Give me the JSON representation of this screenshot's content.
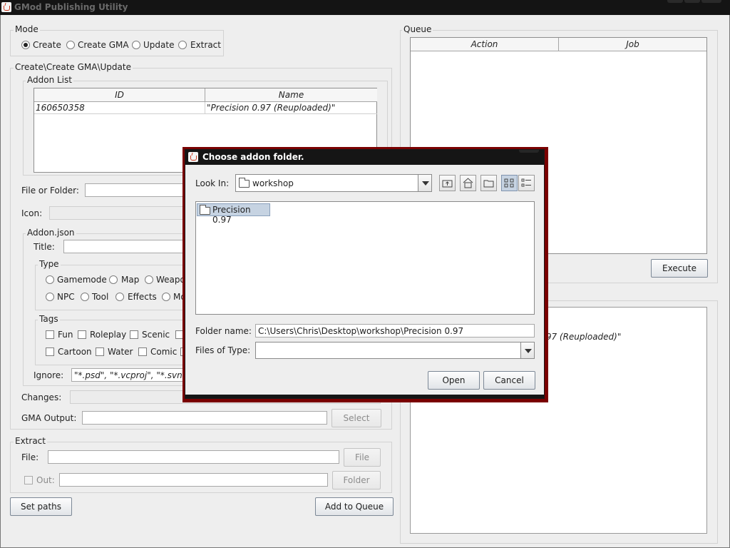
{
  "window": {
    "title": "GMod Publishing Utility"
  },
  "mode": {
    "label": "Mode",
    "options": [
      "Create",
      "Create GMA",
      "Update",
      "Extract"
    ],
    "selected": "Create"
  },
  "create": {
    "label": "Create\\Create GMA\\Update",
    "addon_list": {
      "label": "Addon List",
      "columns": [
        "ID",
        "Name"
      ],
      "rows": [
        {
          "id": "160650358",
          "name": "\"Precision 0.97 (Reuploaded)\""
        }
      ]
    },
    "file_or_folder_label": "File or Folder:",
    "icon_label": "Icon:",
    "addon_json": {
      "label": "Addon.json",
      "title_label": "Title:",
      "type_label": "Type",
      "types": [
        "Gamemode",
        "Map",
        "Weapo",
        "NPC",
        "Tool",
        "Effects",
        "Mo"
      ],
      "tags_label": "Tags",
      "tags": [
        "Fun",
        "Roleplay",
        "Scenic",
        "Cartoon",
        "Water",
        "Comic"
      ],
      "ignore_label": "Ignore:",
      "ignore_value": "\"*.psd\", \"*.vcproj\", \"*.svn*\""
    },
    "changes_label": "Changes:",
    "gma_output_label": "GMA Output:",
    "select_button": "Select"
  },
  "extract": {
    "label": "Extract",
    "file_label": "File:",
    "file_button": "File",
    "out_label": "Out:",
    "folder_button": "Folder"
  },
  "buttons": {
    "set_paths": "Set paths",
    "add_to_queue": "Add to Queue",
    "execute": "Execute"
  },
  "queue": {
    "label": "Queue",
    "columns": [
      "Action",
      "Job"
    ]
  },
  "log": {
    "visible_text": ".97 (Reuploaded)\""
  },
  "dialog": {
    "title": "Choose addon folder.",
    "look_in_label": "Look In:",
    "look_in_value": "workshop",
    "items": [
      "Precision 0.97"
    ],
    "folder_name_label": "Folder name:",
    "folder_name_value": "C:\\Users\\Chris\\Desktop\\workshop\\Precision 0.97",
    "files_of_type_label": "Files of Type:",
    "files_of_type_value": "",
    "open_button": "Open",
    "cancel_button": "Cancel",
    "toolbar_icons": [
      "up-folder-icon",
      "home-icon",
      "new-folder-icon",
      "list-view-icon",
      "details-view-icon"
    ]
  },
  "colors": {
    "dialog_border": "#7a0000",
    "selection": "#c6d3e2",
    "titlebar": "#141414"
  }
}
